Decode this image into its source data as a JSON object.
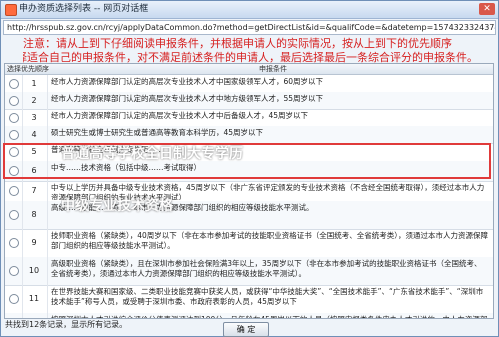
{
  "window": {
    "title": "申办资质选择列表 -- 网页对话框",
    "url": "http://hrsspub.sz.gov.cn/rcyj/applyDataCommon.do?method=getDirectList&id=&qualifCode=&datetemp=1574323324374&csrftok"
  },
  "notice": {
    "line1": "注意：请从上到下仔细阅读申报条件，并根据申请人的实际情况，按从上到下的优先顺序",
    "line2": "选择适合自己的申报条件，对不满足前述条件的申请人，最后选择最后一条综合评分的申报条件。"
  },
  "table": {
    "col_select": "选择优先顺序",
    "col_condition": "申报条件",
    "rows": [
      {
        "num": "1",
        "text": "经市人力资源保障部门认定的高层次专业技术人才中国家级领军人才，60周岁以下"
      },
      {
        "num": "2",
        "text": "经市人力资源保障部门认定的高层次专业技术人才中地方级领军人才，55周岁以下"
      },
      {
        "num": "3",
        "text": "经市人力资源保障部门认定的高层次专业技术人才中后备级人才，45周岁以下"
      },
      {
        "num": "4",
        "text": "硕士研究生或博士研究生或普通高等教育本科学历，45周岁以下"
      },
      {
        "num": "5",
        "text": "普通高等学校全日制大专学历……"
      },
      {
        "num": "6",
        "text": "中专……技术资格（包括中级……考试取得）"
      },
      {
        "num": "7",
        "text": "中专以上学历并具备中级专业技术资格，45周岁以下（非广东省评定颁发的专业技术资格（不含经全国统考取得），须经过本市人力资源保障部门组织的专业技术水平测试）"
      },
      {
        "num": "8",
        "text": "高级……技能……须……本市人力资源保障部门组织的相应等级技能水平测试。"
      },
      {
        "num": "9",
        "text": "技师职业资格（紧缺类），40周岁以下（非在本市参加考试的技能职业资格证书（全国统考、全省统考类），须通过本市人力资源保障部门组织的相应等级技能水平测试）。"
      },
      {
        "num": "10",
        "text": "高级职业资格（紧缺类），且在深圳市参加社会保险满3年以上，35周岁以下（非在本市参加考试的技能职业资格证书（全国统考、全省统考类），须通过本市人力资源保障部门组织的相应等级技能水平测试）。"
      },
      {
        "num": "11",
        "text": "在世界技能大赛和国家级、二类职业技能竞赛中获奖人员，或获得“中华技能大奖”、“全国技术能手”、“广东省技术能手”、“深圳市技术能手”称号人员，或受聘于深圳市委、市政府表彰的人员，45周岁以下"
      },
      {
        "num": "12",
        "text": "按照深圳市人才引进综合评价分值表测评达到100分，且年龄在45周岁以下的人员（按照申报类条件申办人才引进的，由人力资源部门在受理后组织的专业证测评）"
      }
    ]
  },
  "overlay": {
    "line1": "普通高等学校全日制大专学历",
    "line2": "中级专业技术资格"
  },
  "footer": {
    "status": "共找到12条记录，显示所有记录。",
    "ok_label": "确 定"
  }
}
